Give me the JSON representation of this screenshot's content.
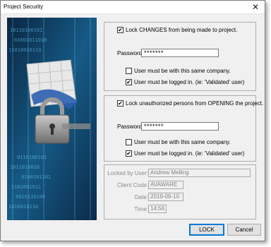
{
  "window": {
    "title": "Project Security",
    "close_glyph": "✕"
  },
  "lock_changes": {
    "label": "Lock CHANGES from being made to project.",
    "checked": true,
    "password_label": "Password:",
    "password_value": "*******",
    "same_company_label": "User must be with this same company.",
    "same_company_checked": false,
    "logged_in_label": "User must be logged in. (ie: 'Validated' user)",
    "logged_in_checked": true
  },
  "lock_opening": {
    "label": "Lock unauthorized persons from OPENING the project.",
    "checked": true,
    "password_label": "Password:",
    "password_value": "*******",
    "same_company_label": "User must be with this same company.",
    "same_company_checked": false,
    "logged_in_label": "User must be logged in. (ie: 'Validated' user)",
    "logged_in_checked": true
  },
  "info": {
    "locked_by_label": "Locked by User:",
    "locked_by_value": "Andrew Melling",
    "client_code_label": "Client Code:",
    "client_code_value": "AVAWARE",
    "date_label": "Date:",
    "date_value": "2019-09-10",
    "time_label": "Time:",
    "time_value": "14:56"
  },
  "buttons": {
    "lock": "LOCK",
    "cancel": "Cancel"
  },
  "icons": {
    "checkmark": "✔",
    "image": "padlock-document-icon"
  },
  "colors": {
    "art_background": "#0d2f4c",
    "default_button_border": "#0078d7"
  }
}
